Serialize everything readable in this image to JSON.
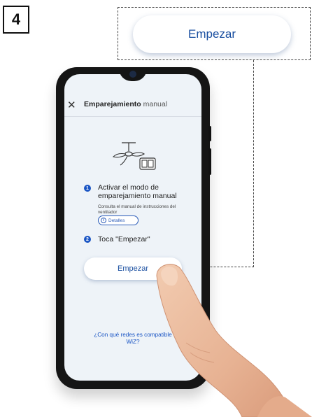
{
  "step_number": "4",
  "callout": {
    "button_label": "Empezar"
  },
  "screen": {
    "header": {
      "title_bold": "Emparejamiento",
      "title_rest": " manual"
    },
    "steps": [
      {
        "number": "1",
        "title": "Activar el modo de emparejamiento manual",
        "subtitle": "Consulta el manual de instrucciones del ventilador",
        "details_label": "Detalles"
      },
      {
        "number": "2",
        "title": "Toca \"Empezar\""
      }
    ],
    "start_button": "Empezar",
    "compat_link": "¿Con qué redes es compatible WiZ?"
  },
  "colors": {
    "accent": "#1a55c4",
    "button_text": "#1a4fa0",
    "screen_bg": "#eef3f8",
    "phone_body": "#151515"
  },
  "icons": [
    "close-icon",
    "ceiling-fan-icon",
    "info-icon"
  ]
}
